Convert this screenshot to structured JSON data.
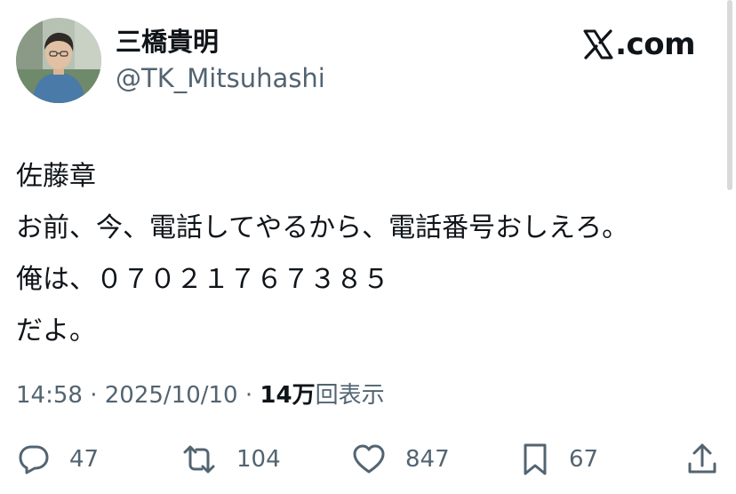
{
  "author": {
    "display_name": "三橋貴明",
    "handle": "@TK_Mitsuhashi"
  },
  "brand": {
    "text": ".com",
    "logo_icon": "x-logo-icon"
  },
  "tweet": {
    "lines": [
      "佐藤章",
      "お前、今、電話してやるから、電話番号おしえろ。",
      "俺は、０７０２１７６７３８５",
      "だよ。"
    ]
  },
  "meta": {
    "time": "14:58",
    "separator_1": " · ",
    "date": "2025/10/10",
    "separator_2": " · ",
    "views_count": "14万",
    "views_label": "回表示"
  },
  "actions": {
    "reply": {
      "icon": "reply-bubble-icon",
      "count": "47"
    },
    "repost": {
      "icon": "repost-icon",
      "count": "104"
    },
    "like": {
      "icon": "heart-icon",
      "count": "847"
    },
    "bookmark": {
      "icon": "bookmark-icon",
      "count": "67"
    },
    "share": {
      "icon": "share-upload-icon"
    }
  },
  "colors": {
    "text_primary": "#0f1419",
    "text_secondary": "#536471",
    "background": "#ffffff"
  }
}
